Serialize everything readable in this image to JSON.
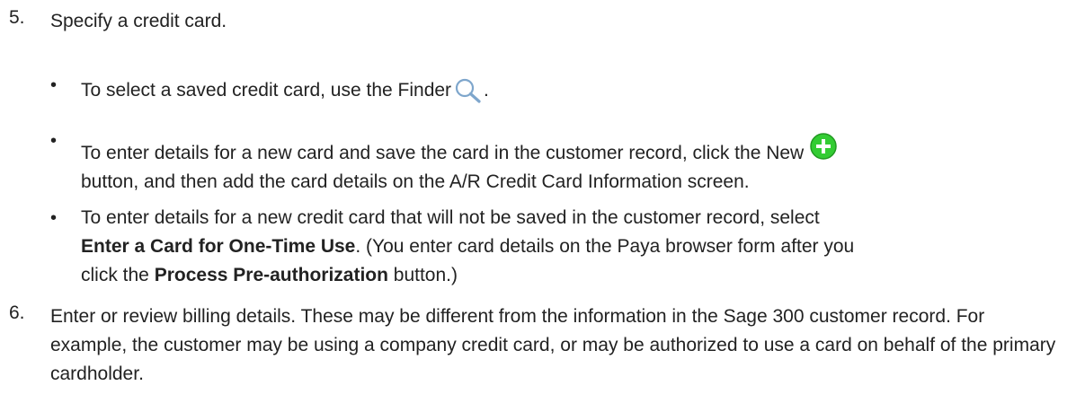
{
  "steps": [
    {
      "number": "5.",
      "text": "Specify a credit card.",
      "bullets": [
        {
          "text_before_icon": "To select a saved credit card, use the Finder",
          "icon": "search-icon",
          "text_after_icon": "."
        },
        {
          "text_before_icon": "To enter details for a new card and save the card in the customer record, click the New",
          "icon": "add-circle-icon",
          "text_after_icon": "button, and then add the card details on the A/R Credit Card Information screen."
        },
        {
          "text_part1": "To enter details for a new credit card that will not be saved in the customer record, select",
          "bold1": "Enter a Card for One-Time Use",
          "text_part2": ". (You enter card details on the Paya browser form after you click the",
          "bold2": "Process Pre-authorization",
          "text_part3": " button.)"
        }
      ]
    },
    {
      "number": "6.",
      "text": "Enter or review billing details. These may be different from the information in the Sage 300 customer record. For example, the customer may be using a company credit card, or may be authorized to use a card on behalf of the primary cardholder."
    }
  ],
  "colors": {
    "text": "#222222",
    "finder_icon": "#7ea6cc",
    "new_icon_fill": "#33cc33",
    "new_icon_cross": "#ffffff"
  }
}
